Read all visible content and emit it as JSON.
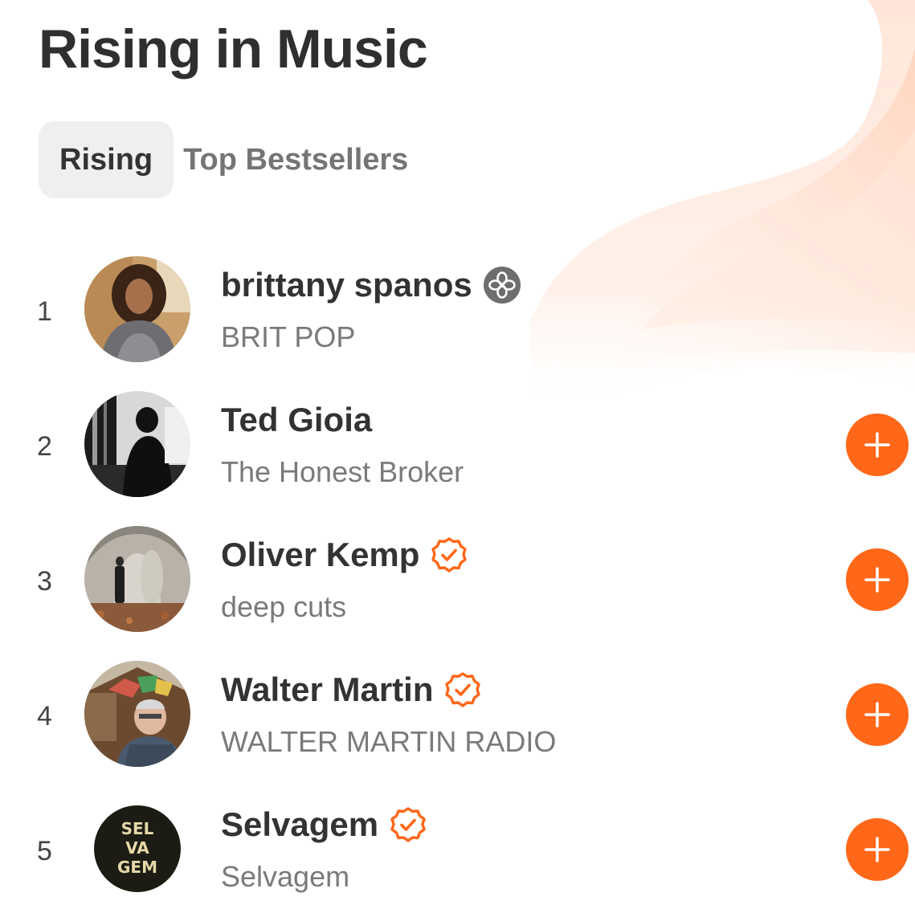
{
  "header": {
    "title": "Rising in Music"
  },
  "tabs": [
    {
      "label": "Rising",
      "active": true
    },
    {
      "label": "Top Bestsellers",
      "active": false
    }
  ],
  "colors": {
    "accent": "#ff6719",
    "active_tab_bg": "#efefef"
  },
  "list": [
    {
      "rank": "1",
      "name": "brittany spanos",
      "publication": "BRIT POP",
      "badge": "bestseller-flower-icon",
      "followable": false
    },
    {
      "rank": "2",
      "name": "Ted Gioia",
      "publication": "The Honest Broker",
      "badge": null,
      "followable": true
    },
    {
      "rank": "3",
      "name": "Oliver Kemp",
      "publication": "deep cuts",
      "badge": "verified-check-icon",
      "followable": true
    },
    {
      "rank": "4",
      "name": "Walter Martin",
      "publication": "WALTER MARTIN RADIO",
      "badge": "verified-check-icon",
      "followable": true
    },
    {
      "rank": "5",
      "name": "Selvagem",
      "publication": "Selvagem",
      "badge": "verified-check-icon",
      "followable": true,
      "avatar_text": [
        "SEL",
        "VA",
        "GEM"
      ]
    }
  ],
  "follow_icon": "plus-icon"
}
